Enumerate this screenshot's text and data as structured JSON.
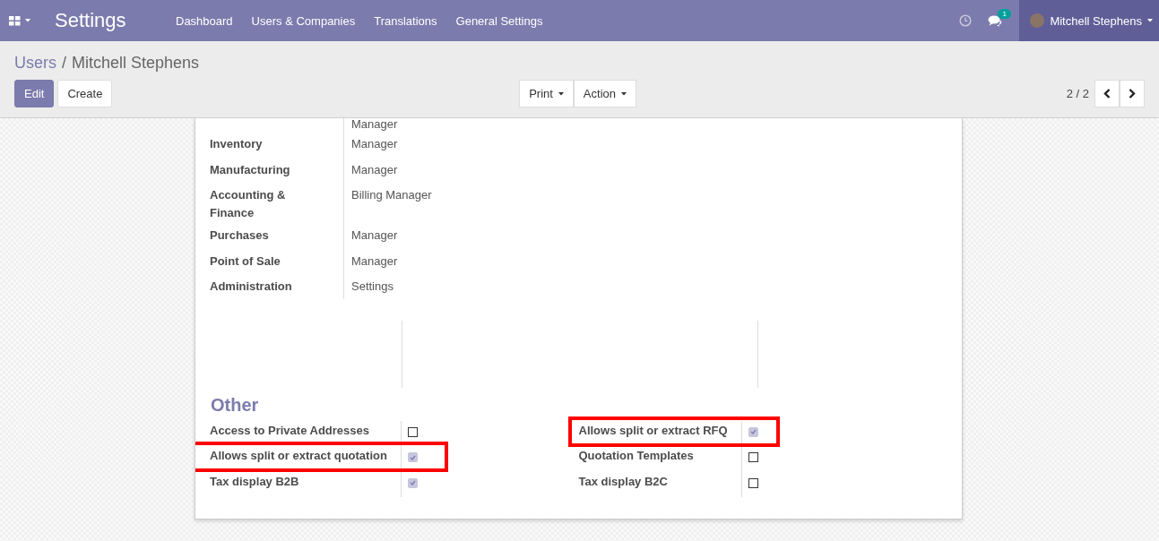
{
  "navbar": {
    "app_title": "Settings",
    "menu": [
      "Dashboard",
      "Users & Companies",
      "Translations",
      "General Settings"
    ],
    "message_count": "1",
    "user_name": "Mitchell Stephens"
  },
  "control_panel": {
    "breadcrumb_separator": "/",
    "breadcrumb": [
      {
        "label": "Users",
        "link": true
      },
      {
        "label": "Mitchell Stephens",
        "link": false
      }
    ],
    "buttons": [
      {
        "label": "Edit",
        "primary": true
      },
      {
        "label": "Create",
        "primary": false
      }
    ],
    "dropdowns": [
      "Print",
      "Action"
    ],
    "pager": "2 / 2"
  },
  "access_rights": [
    {
      "value": "Manager"
    },
    {
      "label": "Inventory",
      "value": "Manager"
    },
    {
      "label": "Manufacturing",
      "value": "Manager"
    },
    {
      "label": "Accounting & Finance",
      "value": "Billing Manager"
    },
    {
      "label": "Purchases",
      "value": "Manager"
    },
    {
      "label": "Point of Sale",
      "value": "Manager"
    },
    {
      "label": "Administration",
      "value": "Settings"
    }
  ],
  "other": {
    "title": "Other",
    "columns": [
      [
        {
          "label": "Access to Private Addresses",
          "checked": false,
          "highlighted": false
        },
        {
          "label": "Allows split or extract quotation",
          "checked": true,
          "highlighted": true
        },
        {
          "label": "Tax display B2B",
          "checked": true,
          "highlighted": false
        }
      ],
      [
        {
          "label": "Allows split or extract RFQ",
          "checked": true,
          "highlighted": true
        },
        {
          "label": "Quotation Templates",
          "checked": false,
          "highlighted": false
        },
        {
          "label": "Tax display B2C",
          "checked": false,
          "highlighted": false
        }
      ]
    ]
  }
}
